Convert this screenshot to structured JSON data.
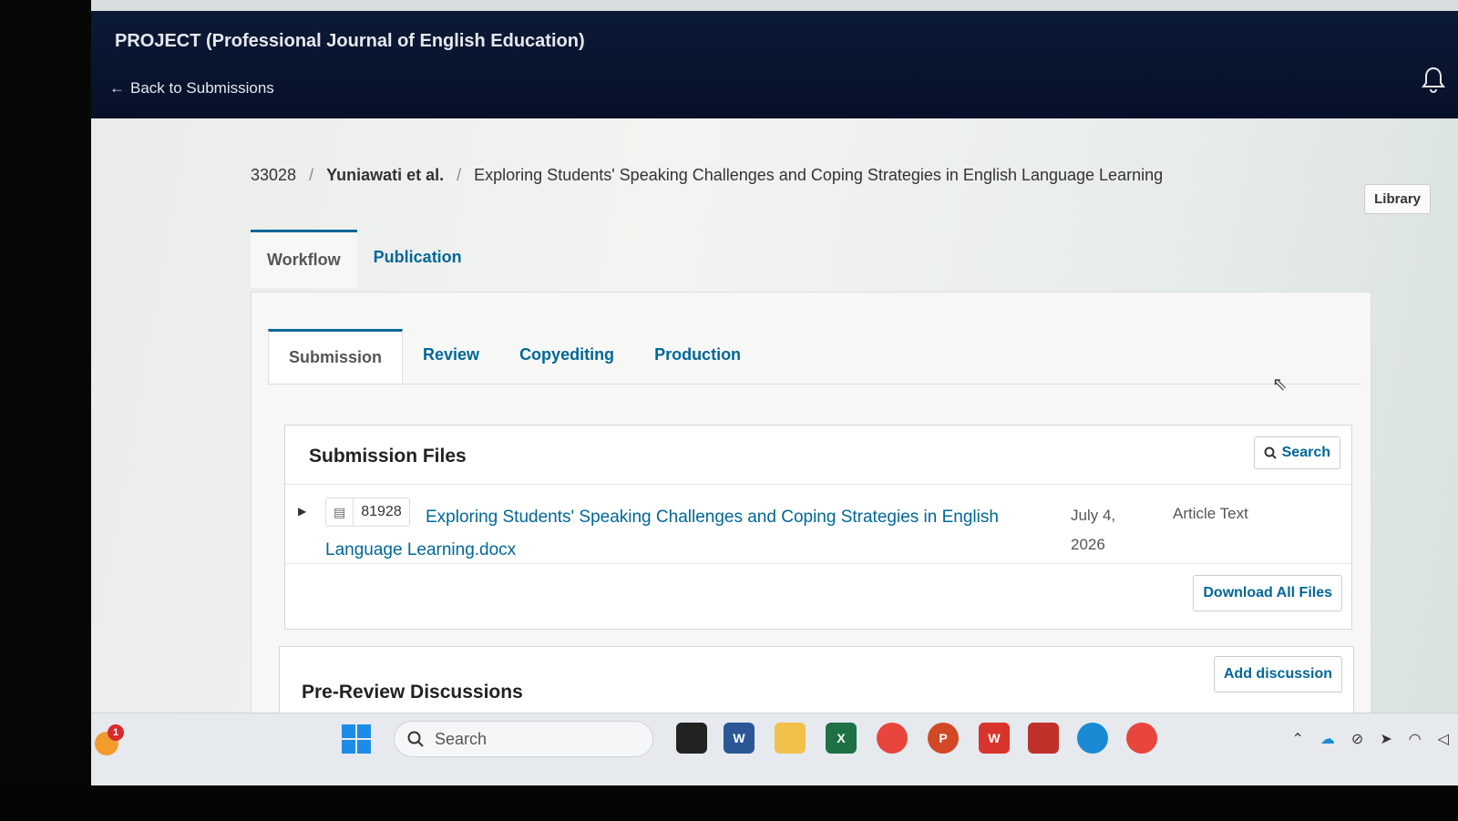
{
  "header": {
    "journal_title": "PROJECT (Professional Journal of English Education)",
    "back_link": "Back to Submissions",
    "back_arrow": "←"
  },
  "breadcrumb": {
    "id": "33028",
    "separator": "/",
    "author": "Yuniawati et al.",
    "title": "Exploring Students' Speaking Challenges and Coping Strategies in English Language Learning"
  },
  "library_button": "Library",
  "main_tabs": [
    {
      "label": "Workflow"
    },
    {
      "label": "Publication"
    }
  ],
  "stage_tabs": [
    {
      "label": "Submission"
    },
    {
      "label": "Review"
    },
    {
      "label": "Copyediting"
    },
    {
      "label": "Production"
    }
  ],
  "submission_files": {
    "title": "Submission Files",
    "search_label": "Search",
    "files": [
      {
        "id": "81928",
        "name": "Exploring Students' Speaking Challenges and Coping Strategies in English Language Learning.docx",
        "date": "July 4, 2026",
        "type": "Article Text"
      }
    ],
    "download_all_label": "Download All Files"
  },
  "discussions": {
    "title": "Pre-Review Discussions",
    "add_label": "Add discussion"
  },
  "taskbar": {
    "search_placeholder": "Search",
    "weather_badge": "1",
    "apps": [
      {
        "icon": "word-icon",
        "label": "W",
        "color": "#2b5797"
      },
      {
        "icon": "file-explorer-icon",
        "label": "",
        "color": "#f2c14b"
      },
      {
        "icon": "excel-icon",
        "label": "X",
        "color": "#1e7145"
      },
      {
        "icon": "chrome-icon",
        "label": "",
        "color": "#e8453c"
      },
      {
        "icon": "powerpoint-icon",
        "label": "P",
        "color": "#d24726"
      },
      {
        "icon": "wps-icon",
        "label": "W",
        "color": "#d9342b"
      },
      {
        "icon": "app-icon",
        "label": "",
        "color": "#c0312b"
      },
      {
        "icon": "edge-icon",
        "label": "",
        "color": "#1a8ad4"
      },
      {
        "icon": "chrome-profile-icon",
        "label": "",
        "color": "#e8453c"
      }
    ]
  },
  "colors": {
    "header_bg": "#071029",
    "link": "#006798"
  }
}
